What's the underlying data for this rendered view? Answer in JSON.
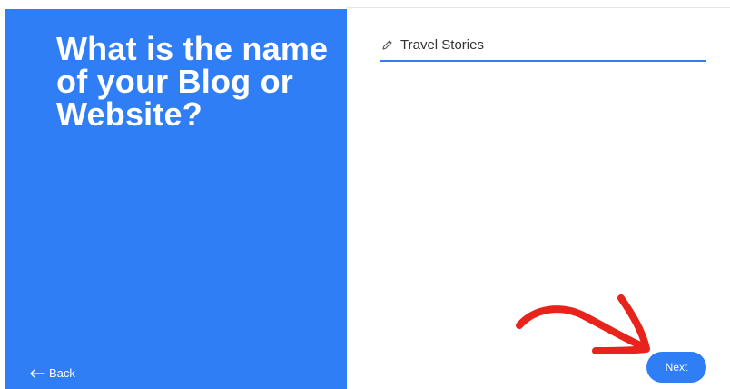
{
  "left_panel": {
    "question": "What is the name of your Blog or Website?",
    "back_label": "Back",
    "accent_color": "#2f7ef6"
  },
  "form": {
    "site_name_value": "Travel Stories",
    "edit_icon": "pencil-icon"
  },
  "footer": {
    "next_label": "Next"
  },
  "annotation": {
    "arrow_icon": "red-arrow-icon",
    "arrow_color": "#e8231c"
  }
}
